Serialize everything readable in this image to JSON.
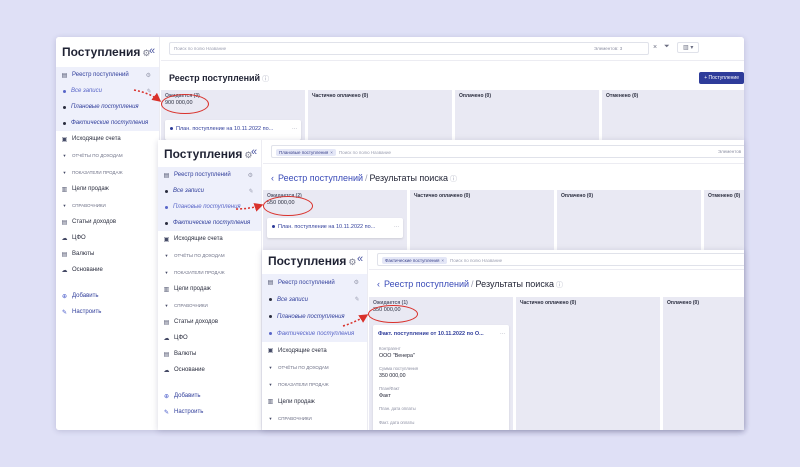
{
  "app": {
    "title": "Поступления",
    "collapse": "«"
  },
  "menu": {
    "registry": "Реестр поступлений",
    "all": "Все записи",
    "planned": "Плановые поступления",
    "actual": "Фактические поступления",
    "outgoing": "Исходящие счета",
    "sec_reports": "ОТЧЁТЫ ПО ДОХОДАМ",
    "sec_kpi": "ПОКАЗАТЕЛИ ПРОДАЖ",
    "goals": "Цели продаж",
    "sec_refs": "СПРАВОЧНИКИ",
    "income_items": "Статьи доходов",
    "cfo": "ЦФО",
    "currencies": "Валюты",
    "basis": "Основание",
    "add": "Добавить",
    "configure": "Настроить"
  },
  "search": {
    "placeholder": "Поиск по полю Название",
    "chip_planned": "Плановые поступления",
    "chip_actual": "Фактические поступления",
    "count": "Элементов: 3",
    "count_cut": "Элементов"
  },
  "page": {
    "title": "Реестр поступлений",
    "back": "‹",
    "sep": "/",
    "results": "Результаты поиска",
    "add_button": "+ Поступление"
  },
  "columns": {
    "pending_1": "Ожидается (3)",
    "pending_2": "Ожидается (2)",
    "pending_3": "Ожидается (1)",
    "partial": "Частично оплачено (0)",
    "paid": "Оплачено (0)",
    "cancelled": "Отменено (0)"
  },
  "sums": {
    "s1": "900 000,00",
    "s2": "550 000,00",
    "s3": "350 000,00"
  },
  "cards": {
    "planned_title": "План. поступление на 10.11.2022 по...",
    "actual_title": "Факт. поступление от 10.11.2022 по О...",
    "more": "···",
    "contractor_label": "Контрагент",
    "contractor_value": "ООО \"Венера\"",
    "amount_label": "Сумма поступления",
    "amount_value": "350 000,00",
    "planfact_label": "План/Факт",
    "planfact_value": "Факт",
    "plan_date_label": "План. дата оплаты",
    "fact_date_label": "Факт. дата оплаты"
  },
  "colors": {
    "accent": "#2e3c9a",
    "highlight": "#d9312b",
    "backdrop": "#dfe0f6"
  },
  "icons": [
    "gear-icon",
    "collapse-icon",
    "registry-icon",
    "edit-icon",
    "invoice-icon",
    "triangle-icon",
    "target-icon",
    "list-icon",
    "cloud-icon",
    "currency-icon",
    "plus-icon",
    "wrench-icon",
    "filter-icon",
    "view-icon",
    "help-icon",
    "info-icon"
  ]
}
